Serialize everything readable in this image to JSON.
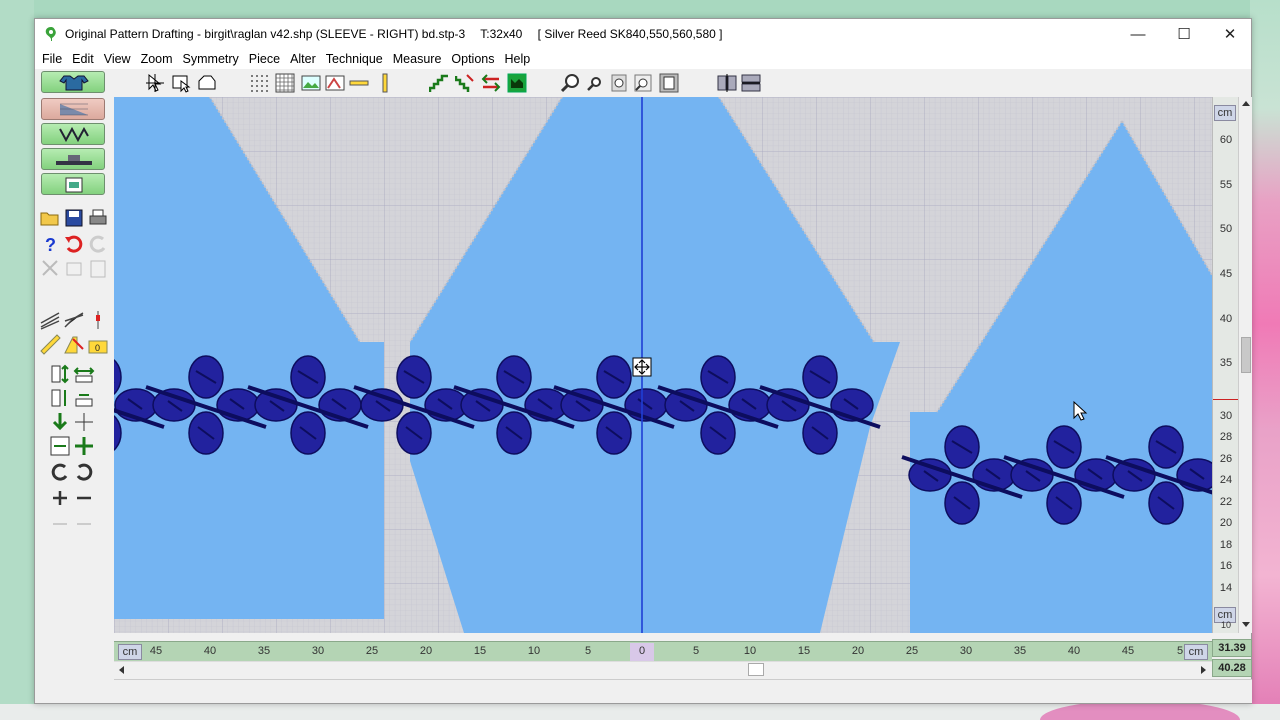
{
  "window": {
    "title_parts": [
      "Original Pattern Drafting - birgit\\raglan v42.shp (SLEEVE - RIGHT)  bd.stp-3",
      "T:32x40",
      "[ Silver Reed SK840,550,560,580 ]"
    ],
    "minimize": "—",
    "maximize": "☐",
    "close": "✕"
  },
  "menu": [
    "File",
    "Edit",
    "View",
    "Zoom",
    "Symmetry",
    "Piece",
    "Alter",
    "Technique",
    "Measure",
    "Options",
    "Help"
  ],
  "toolbar_icons": [
    "pointer-select-icon",
    "select-box-icon",
    "lasso-icon",
    "dot-grid-icon",
    "grid-icon",
    "image-icon",
    "pattern-image-icon",
    "horizontal-line-icon",
    "vertical-line-icon",
    "stairs-up-icon",
    "stairs-down-icon",
    "arrows-icon",
    "knit-pattern-icon",
    "zoom-in-icon",
    "zoom-out-icon",
    "zoom-fit-icon",
    "zoom-area-icon",
    "zoom-page-icon",
    "mirror-vertical-icon",
    "mirror-horizontal-icon"
  ],
  "rulers": {
    "unit": "cm",
    "vertical_upper": [
      "60",
      "55",
      "50",
      "45",
      "40",
      "35"
    ],
    "vertical_lower": [
      "30",
      "28",
      "26",
      "24",
      "22",
      "20",
      "18",
      "16",
      "14",
      "10"
    ],
    "horizontal": [
      "45",
      "40",
      "35",
      "30",
      "25",
      "20",
      "15",
      "10",
      "5",
      "0",
      "5",
      "10",
      "15",
      "20",
      "25",
      "30",
      "35",
      "40",
      "45",
      "5"
    ]
  },
  "coords": {
    "x": "31.39",
    "y": "40.28"
  },
  "colors": {
    "fabric": "#74b4f2",
    "motif": "#22229e",
    "motif_dark": "#0d0d5e",
    "grid_bg": "#d4d4d9",
    "center_line": "#1f3fd4"
  }
}
